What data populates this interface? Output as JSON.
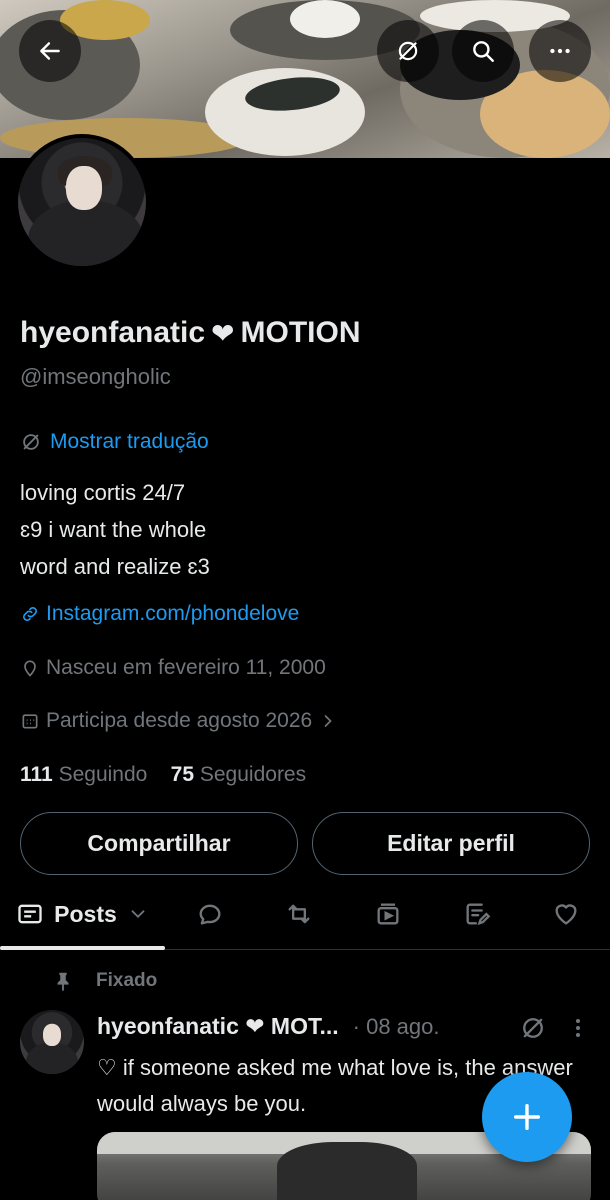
{
  "profile": {
    "display_name": "hyeonfanatic",
    "name_suffix": "MOTION",
    "handle": "@imseongholic",
    "translate_label": "Mostrar tradução",
    "bio_lines": [
      "loving cortis 24/7",
      "ɛ9 i want the whole",
      "word and realize ɛ3"
    ],
    "link": "Instagram.com/phondelove",
    "birthday": "Nasceu em fevereiro 11, 2000",
    "joined": "Participa desde agosto 2026",
    "following_count": "111",
    "following_label": "Seguindo",
    "followers_count": "75",
    "followers_label": "Seguidores"
  },
  "buttons": {
    "share": "Compartilhar",
    "edit": "Editar perfil"
  },
  "tabs": {
    "posts_label": "Posts"
  },
  "post": {
    "pinned_label": "Fixado",
    "author": "hyeonfanatic ❤ MOT...",
    "date": "· 08 ago.",
    "text": "♡ if someone asked me what love is, the answer would always be you."
  },
  "colors": {
    "accent": "#1d9bf0",
    "background": "#000000",
    "secondary_text": "#71767b"
  },
  "icons": [
    "back-arrow-icon",
    "translate-icon",
    "search-icon",
    "more-icon",
    "link-icon",
    "location-icon",
    "calendar-icon",
    "chevron-right-icon",
    "posts-tab-icon",
    "chevron-down-icon",
    "reply-icon",
    "retweet-icon",
    "media-icon",
    "articles-icon",
    "like-icon",
    "pin-icon",
    "compose-plus-icon"
  ]
}
